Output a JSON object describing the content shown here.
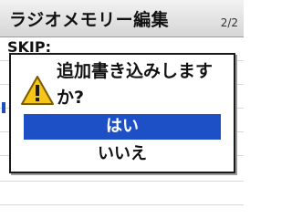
{
  "header": {
    "title": "ラジオメモリー編集",
    "page_indicator": "2/2"
  },
  "background": {
    "row_label": "SKIP:"
  },
  "dialog": {
    "icon": "warning-icon",
    "message_line1": "追加書き込みします",
    "message_line2": "か?",
    "yes_label": "はい",
    "no_label": "いいえ",
    "selected": "yes"
  },
  "colors": {
    "selection": "#1d50c6",
    "warning_fill": "#f5c518"
  }
}
